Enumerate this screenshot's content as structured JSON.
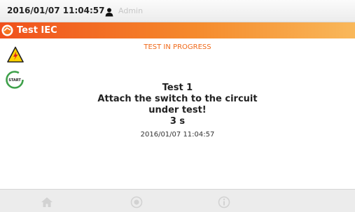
{
  "status_bar": {
    "datetime": "2016/01/07 11:04:57",
    "user_icon": "user-icon",
    "username": "Admin"
  },
  "title_bar": {
    "logo_icon": "logo-icon",
    "title": "Test IEC"
  },
  "tools": {
    "warning_icon": "high-voltage-warning-icon",
    "start_label": "START"
  },
  "main": {
    "state": "TEST IN PROGRESS",
    "test_name": "Test 1",
    "instruction_line1": "Attach the switch to the circuit",
    "instruction_line2": "under test!",
    "countdown": "3 s",
    "timestamp": "2016/01/07 11:04:57"
  },
  "bottom_nav": {
    "home_icon": "home-icon",
    "record_icon": "record-icon",
    "info_icon": "info-icon"
  },
  "colors": {
    "accent": "#f06a1a",
    "title_bar_start": "#f0501c",
    "start_ring": "#3ea04a"
  }
}
